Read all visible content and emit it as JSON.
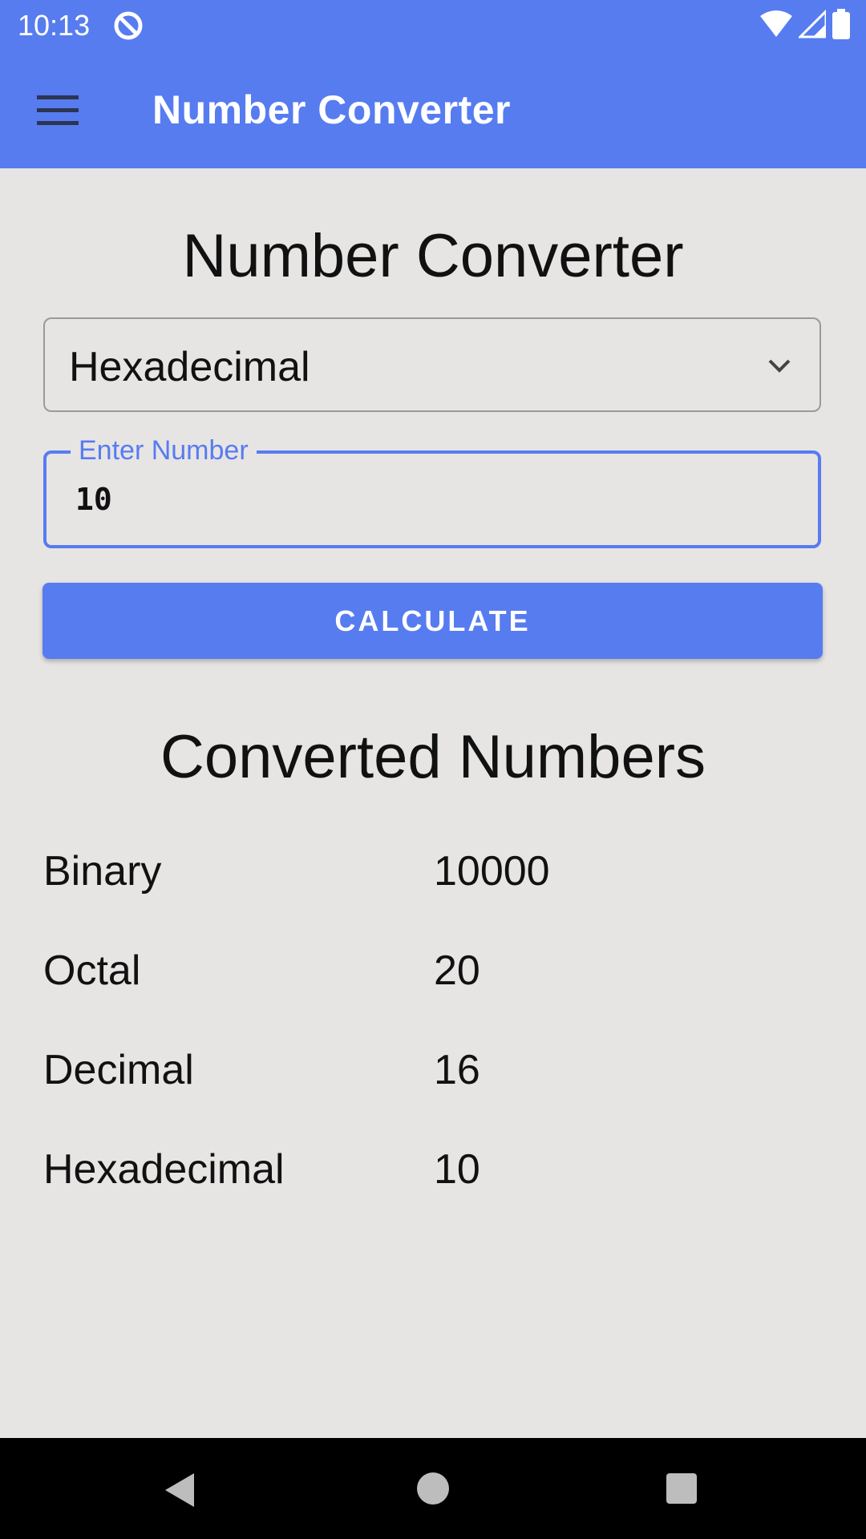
{
  "status_bar": {
    "time": "10:13"
  },
  "app_bar": {
    "title": "Number Converter",
    "menu_icon": "hamburger-menu-icon",
    "color": "#577cf0"
  },
  "form": {
    "heading": "Number Converter",
    "base_select": {
      "selected": "Hexadecimal"
    },
    "number_input": {
      "label": "Enter Number",
      "value": "10"
    },
    "calculate_label": "CALCULATE"
  },
  "results": {
    "heading": "Converted Numbers",
    "rows": [
      {
        "label": "Binary",
        "value": "10000"
      },
      {
        "label": "Octal",
        "value": "20"
      },
      {
        "label": "Decimal",
        "value": "16"
      },
      {
        "label": "Hexadecimal",
        "value": "10"
      }
    ]
  }
}
